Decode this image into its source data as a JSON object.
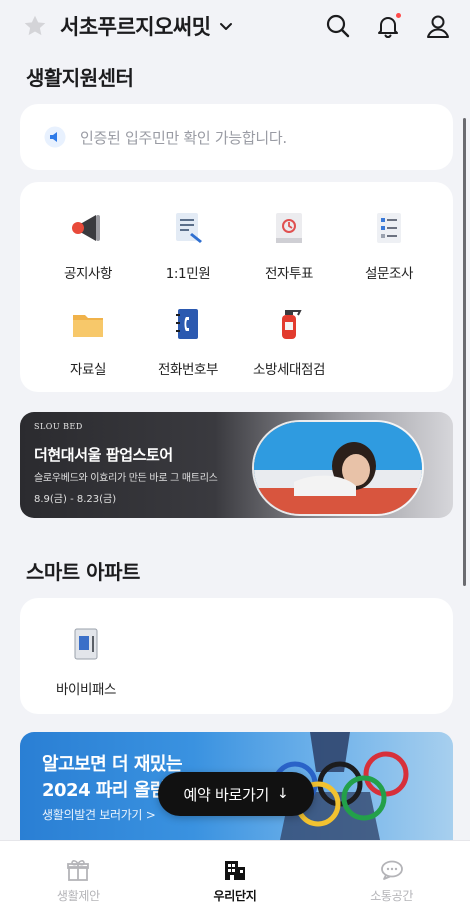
{
  "header": {
    "title": "서초푸르지오써밋",
    "icons": [
      "star-icon",
      "chevron-down-icon",
      "search-icon",
      "bell-icon",
      "user-icon"
    ]
  },
  "life_support": {
    "section_title": "생활지원센터",
    "notice_text": "인증된 입주민만 확인 가능합니다.",
    "menu": [
      {
        "label": "공지사항",
        "icon": "megaphone-icon"
      },
      {
        "label": "1:1민원",
        "icon": "document-pen-icon"
      },
      {
        "label": "전자투표",
        "icon": "vote-icon"
      },
      {
        "label": "설문조사",
        "icon": "survey-icon"
      },
      {
        "label": "자료실",
        "icon": "folder-icon"
      },
      {
        "label": "전화번호부",
        "icon": "phonebook-icon"
      },
      {
        "label": "소방세대점검",
        "icon": "fire-extinguisher-icon"
      }
    ]
  },
  "banner_popup": {
    "brand": "SLOU BED",
    "title": "더현대서울 팝업스토어",
    "subtitle": "슬로우베드와 이효리가 만든 바로 그 매트리스",
    "dates": "8.9(금) - 8.23(금)"
  },
  "smart_apartment": {
    "section_title": "스마트 아파트",
    "items": [
      {
        "label": "바이비패스",
        "icon": "door-pass-icon"
      }
    ]
  },
  "banner_olympic": {
    "line1": "알고보면 더 재밌는",
    "line2": "2024 파리 올림",
    "line3": "생활의발견 보러가기 >"
  },
  "floating_button": {
    "label": "예약 바로가기",
    "arrow": "↓"
  },
  "tabbar": {
    "tabs": [
      {
        "label": "생활제안",
        "icon": "gift-icon",
        "active": false
      },
      {
        "label": "우리단지",
        "icon": "building-icon",
        "active": true
      },
      {
        "label": "소통공간",
        "icon": "chat-icon",
        "active": false
      }
    ]
  }
}
